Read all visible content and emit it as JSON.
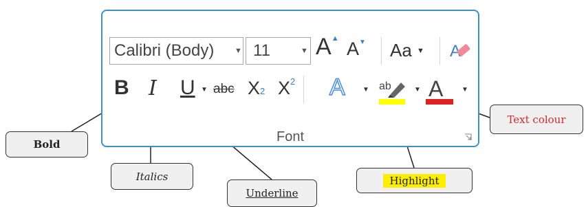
{
  "ribbon": {
    "group_label": "Font",
    "font_name": "Calibri (Body)",
    "font_size": "11",
    "change_case_label": "Aa",
    "strikethrough_label": "abc",
    "subscript_label": "X",
    "subscript_mark": "2",
    "superscript_label": "X",
    "superscript_mark": "2",
    "bold_label": "B",
    "italic_label": "I",
    "underline_label": "U",
    "highlight_glyph": "ab",
    "font_color_glyph": "A",
    "grow_label": "A",
    "shrink_label": "A",
    "text_effects_label": "A"
  },
  "colors": {
    "panel_border": "#3f8fc8",
    "highlight": "#ffff00",
    "font_color": "#e02020",
    "callout_text_red": "#d9262c"
  },
  "callouts": {
    "bold": "Bold",
    "italics": "Italics",
    "underline": "Underline",
    "highlight": "Highlight",
    "text_colour": "Text colour"
  }
}
